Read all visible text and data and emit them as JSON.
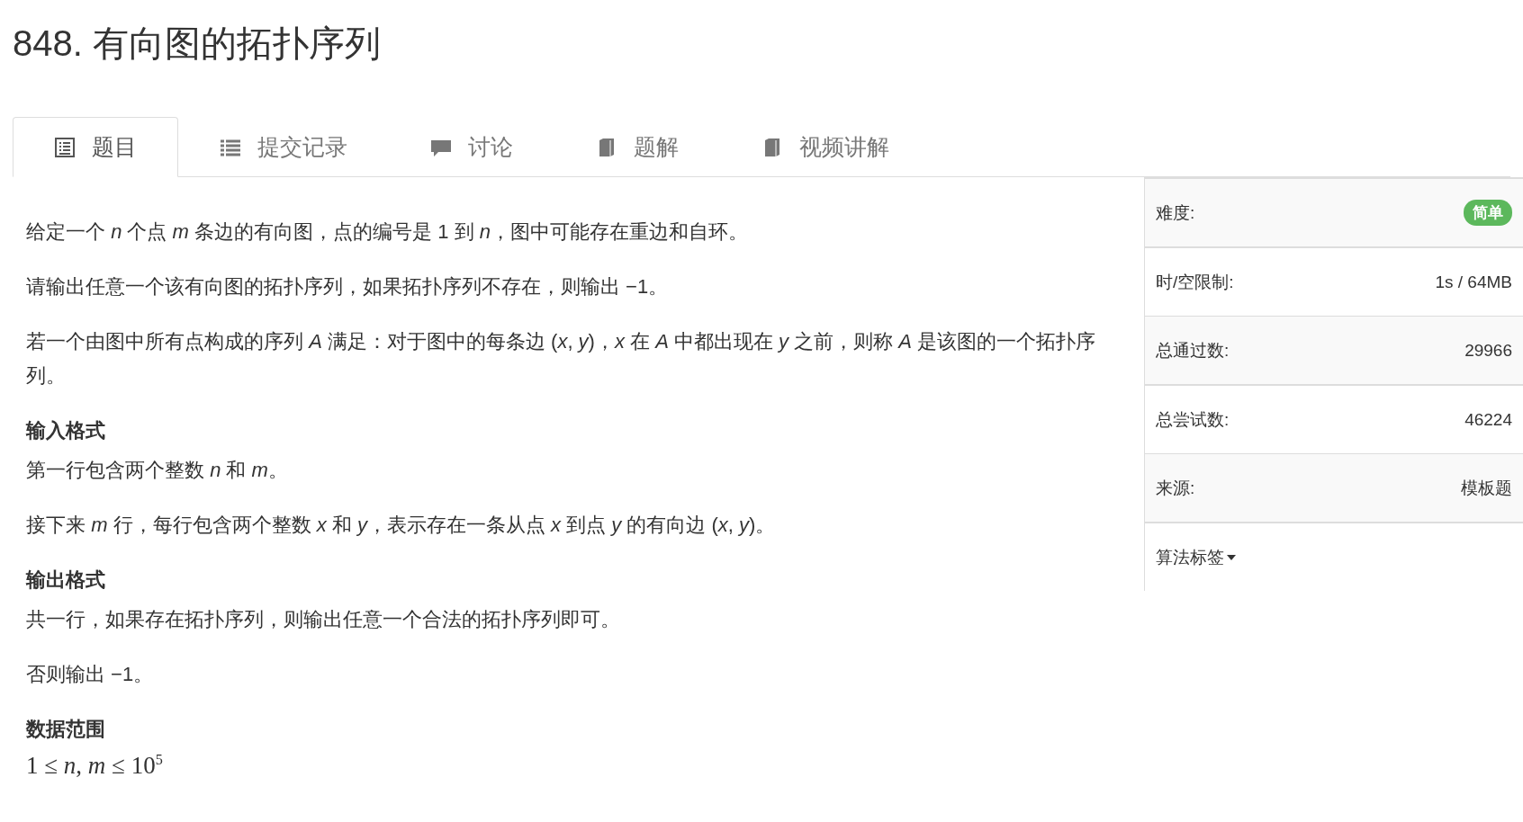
{
  "title": "848. 有向图的拓扑序列",
  "tabs": [
    {
      "label": "题目",
      "kind": "list",
      "selected": true
    },
    {
      "label": "提交记录",
      "kind": "bullets",
      "selected": false
    },
    {
      "label": "讨论",
      "kind": "comment",
      "selected": false
    },
    {
      "label": "题解",
      "kind": "book",
      "selected": false
    },
    {
      "label": "视频讲解",
      "kind": "book",
      "selected": false
    }
  ],
  "content": [
    {
      "kind": "paragraph",
      "text": "给定一个 *n* 个点 *m* 条边的有向图，点的编号是 1 到 *n*，图中可能存在重边和自环。"
    },
    {
      "kind": "paragraph",
      "text": "请输出任意一个该有向图的拓扑序列，如果拓扑序列不存在，则输出 −1。"
    },
    {
      "kind": "paragraph",
      "text": "若一个由图中所有点构成的序列 *A* 满足：对于图中的每条边 (*x*, *y*)，*x* 在 *A* 中都出现在 *y* 之前，则称 *A* 是该图的一个拓扑序列。"
    },
    {
      "kind": "heading",
      "text": "输入格式"
    },
    {
      "kind": "line",
      "text": "第一行包含两个整数 *n* 和 *m*。"
    },
    {
      "kind": "paragraph",
      "text": "接下来 *m* 行，每行包含两个整数 *x* 和 *y*，表示存在一条从点 *x* 到点 *y* 的有向边 (*x*, *y*)。"
    },
    {
      "kind": "heading",
      "text": "输出格式"
    },
    {
      "kind": "line",
      "text": "共一行，如果存在拓扑序列，则输出任意一个合法的拓扑序列即可。"
    },
    {
      "kind": "paragraph",
      "text": "否则输出 −1。"
    },
    {
      "kind": "heading",
      "text": "数据范围"
    },
    {
      "kind": "math",
      "text": "1 ≤ *n*, *m* ≤ 10$^{5}$"
    }
  ],
  "sidebar": [
    {
      "kind": "badge",
      "label": "难度:",
      "value": "简单",
      "color": "#5cb85c"
    },
    {
      "kind": "text",
      "label": "时/空限制:",
      "value": "1s / 64MB"
    },
    {
      "kind": "text",
      "label": "总通过数:",
      "value": "29966"
    },
    {
      "kind": "text",
      "label": "总尝试数:",
      "value": "46224"
    },
    {
      "kind": "text",
      "label": "来源:",
      "value": "模板题"
    },
    {
      "kind": "dropdown",
      "label": "算法标签"
    }
  ]
}
